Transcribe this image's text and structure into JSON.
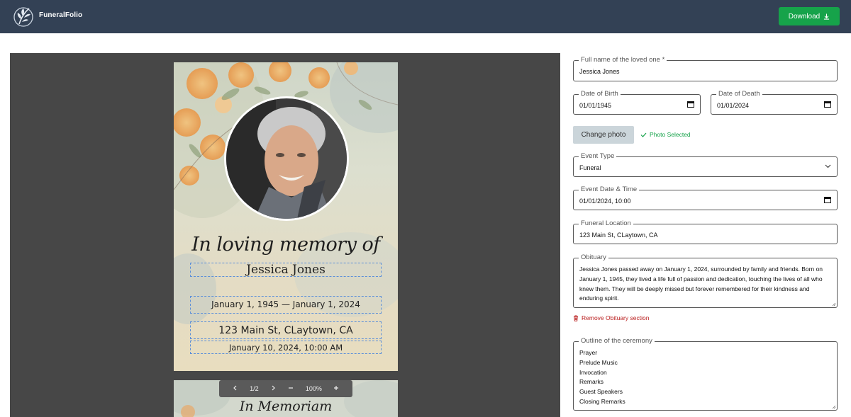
{
  "header": {
    "brand": "FuneralFolio",
    "download_label": "Download"
  },
  "preview": {
    "page1": {
      "heading": "In loving memory of",
      "name": "Jessica Jones",
      "dates": "January 1, 1945 — January 1, 2024",
      "location": "123 Main St, CLaytown, CA",
      "datetime": "January 10, 2024, 10:00 AM"
    },
    "page2": {
      "heading": "In Memoriam"
    },
    "pager": {
      "page_indicator": "1/2",
      "zoom": "100%"
    }
  },
  "form": {
    "full_name": {
      "label": "Full name of the loved one *",
      "value": "Jessica Jones"
    },
    "birth": {
      "label": "Date of Birth",
      "value": "01/01/1945"
    },
    "death": {
      "label": "Date of Death",
      "value": "01/01/2024"
    },
    "change_photo_label": "Change photo",
    "photo_status": "Photo Selected",
    "event_type": {
      "label": "Event Type",
      "value": "Funeral"
    },
    "event_datetime": {
      "label": "Event Date & Time",
      "value": "01/01/2024, 10:00"
    },
    "location": {
      "label": "Funeral Location",
      "value": "123 Main St, CLaytown, CA"
    },
    "obituary": {
      "label": "Obituary",
      "value": "Jessica Jones passed away on January 1, 2024, surrounded by family and friends. Born on January 1, 1945, they lived a life full of passion and dedication, touching the lives of all who knew them. They will be deeply missed but forever remembered for their kindness and enduring spirit."
    },
    "remove_obituary_label": "Remove Obituary section",
    "outline": {
      "label": "Outline of the ceremony",
      "items": [
        "Prayer",
        "Prelude Music",
        "Invocation",
        "Remarks",
        "Guest Speakers",
        "Closing Remarks"
      ]
    }
  },
  "colors": {
    "header_bg": "#334155",
    "download_bg": "#16a34a",
    "preview_bg": "#474747",
    "success": "#16a34a",
    "danger": "#b91c1c"
  }
}
